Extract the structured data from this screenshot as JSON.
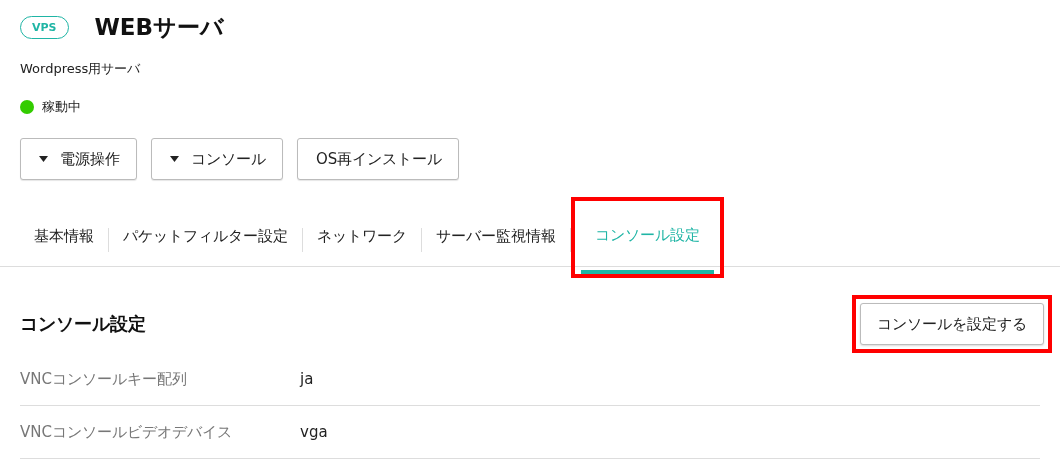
{
  "header": {
    "badge": "VPS",
    "title": "WEBサーバ",
    "description": "Wordpress用サーバ",
    "status": {
      "label": "稼動中",
      "color": "#33cc00"
    }
  },
  "actions": [
    {
      "label": "電源操作",
      "kind": "dropdown"
    },
    {
      "label": "コンソール",
      "kind": "dropdown"
    },
    {
      "label": "OS再インストール",
      "kind": "plain"
    }
  ],
  "tabs": [
    {
      "label": "基本情報",
      "selected": false,
      "highlighted": false
    },
    {
      "label": "パケットフィルター設定",
      "selected": false,
      "highlighted": false
    },
    {
      "label": "ネットワーク",
      "selected": false,
      "highlighted": false
    },
    {
      "label": "サーバー監視情報",
      "selected": false,
      "highlighted": false
    },
    {
      "label": "コンソール設定",
      "selected": true,
      "highlighted": true
    }
  ],
  "section": {
    "title": "コンソール設定",
    "button": {
      "label": "コンソールを設定する",
      "highlighted": true
    },
    "rows": [
      {
        "label": "VNCコンソールキー配列",
        "value": "ja"
      },
      {
        "label": "VNCコンソールビデオデバイス",
        "value": "vga"
      }
    ]
  }
}
